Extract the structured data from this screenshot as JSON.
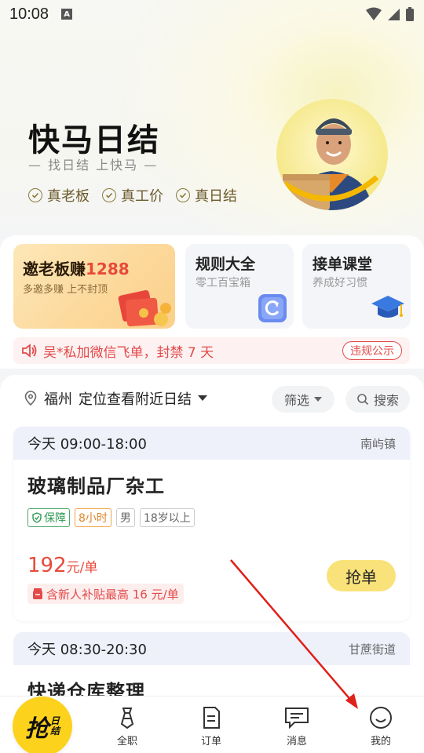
{
  "status_bar": {
    "time": "10:08",
    "a_label": "A"
  },
  "hero": {
    "title": "快马日结",
    "subtitle": "— 找日结 上快马 —",
    "tags": [
      "真老板",
      "真工价",
      "真日结"
    ]
  },
  "cards": {
    "invite": {
      "title_prefix": "邀老板赚",
      "title_num": "1288",
      "sub": "多邀多赚 上不封顶"
    },
    "rules": {
      "title": "规则大全",
      "sub": "零工百宝箱"
    },
    "course": {
      "title": "接单课堂",
      "sub": "养成好习惯"
    }
  },
  "notice": {
    "text": "吴*私加微信飞单，封禁 7 天",
    "pill": "违规公示"
  },
  "location": {
    "city": "福州",
    "hint": "定位查看附近日结"
  },
  "filters": {
    "filter_label": "筛选",
    "search_label": "搜索"
  },
  "jobs": [
    {
      "time": "今天 09:00-18:00",
      "area": "南屿镇",
      "title": "玻璃制品厂杂工",
      "tags": [
        "保障",
        "8小时",
        "男",
        "18岁以上"
      ],
      "price": "192",
      "unit": "元/单",
      "subsidy": "含新人补贴最高 16 元/单",
      "action": "抢单"
    },
    {
      "time": "今天 08:30-20:30",
      "area": "甘蔗街道",
      "title": "快递仓库整理"
    }
  ],
  "tabbar": {
    "grab_big": "抢",
    "grab_small_1": "日",
    "grab_small_2": "结",
    "items": [
      "全职",
      "订单",
      "消息",
      "我的"
    ]
  },
  "colors": {
    "accent": "#fcd21c",
    "price": "#e84a3a",
    "notice": "#e24a4a"
  }
}
